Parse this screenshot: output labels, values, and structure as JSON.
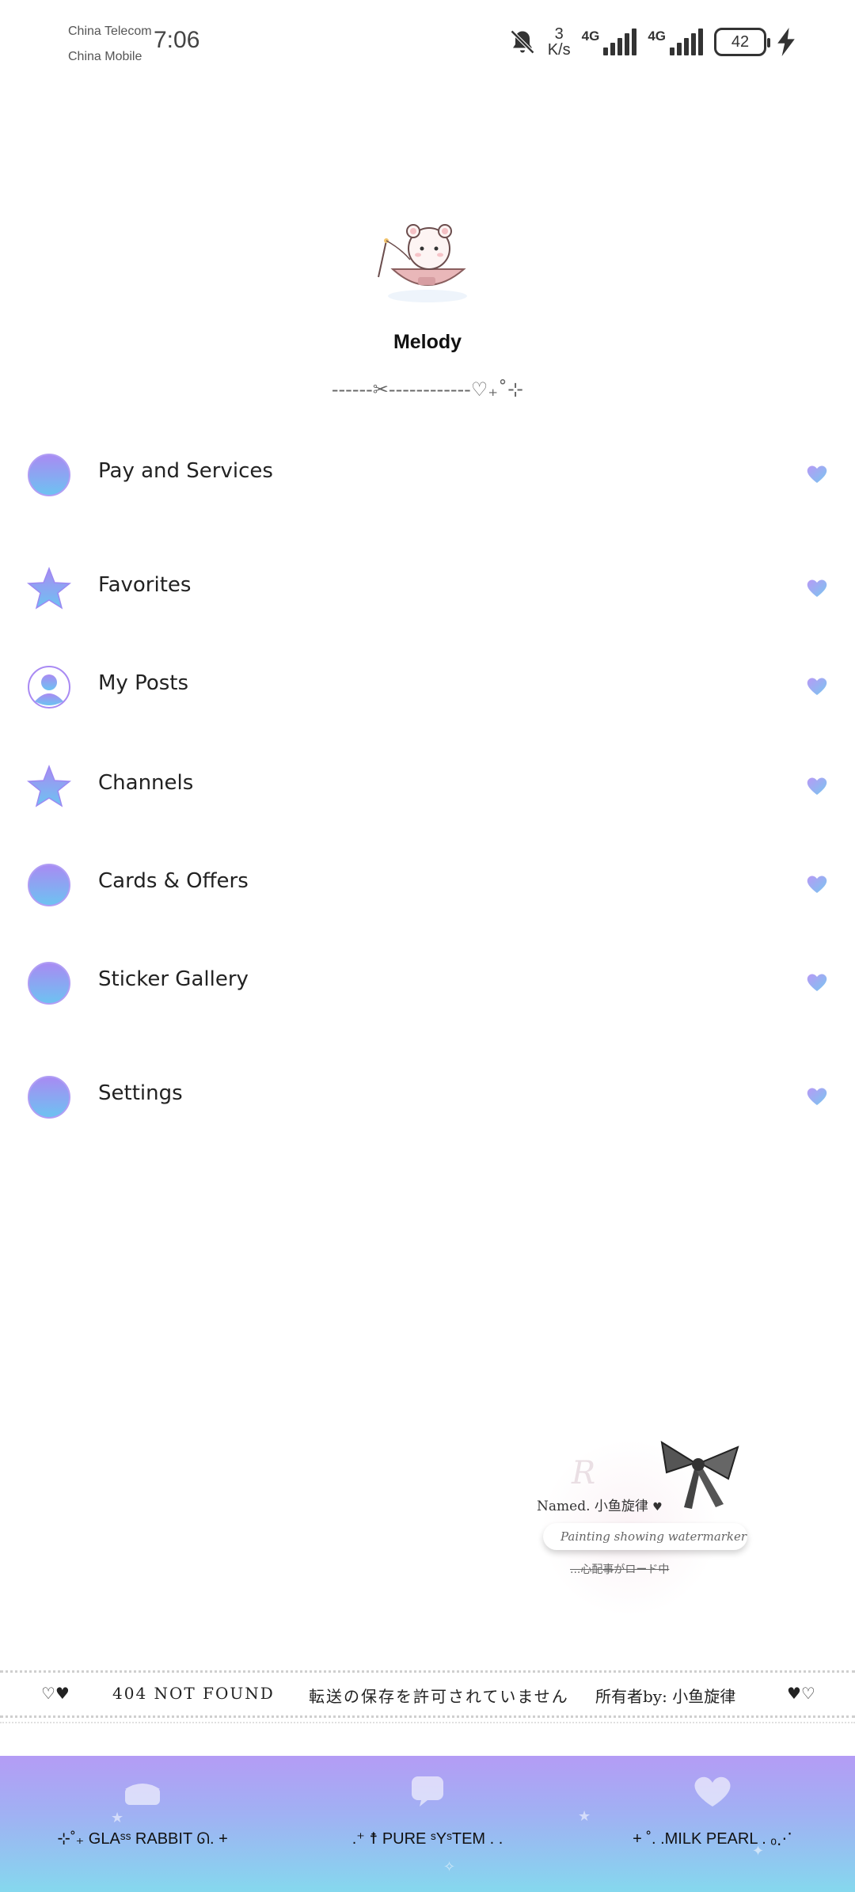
{
  "status_bar": {
    "carrier_1": "China Telecom",
    "carrier_2": "China Mobile",
    "time": "7:06",
    "speed_value": "3",
    "speed_unit": "K/s",
    "network_1": "4G",
    "network_2": "4G",
    "battery": "42",
    "icons": [
      "bell-muted-icon",
      "signal-icon",
      "battery-icon",
      "charging-bolt-icon"
    ]
  },
  "profile": {
    "name": "Melody",
    "divider": "------✂------------♡₊˚⊹",
    "avatar_icon": "bear-in-boat-illustration"
  },
  "menu": {
    "items": [
      {
        "label": "Pay and Services",
        "icon": "round-gradient-icon"
      },
      {
        "label": "Favorites",
        "icon": "star-icon"
      },
      {
        "label": "My Posts",
        "icon": "person-icon"
      },
      {
        "label": "Channels",
        "icon": "star-icon"
      },
      {
        "label": "Cards & Offers",
        "icon": "round-gradient-icon"
      },
      {
        "label": "Sticker Gallery",
        "icon": "round-gradient-icon"
      },
      {
        "label": "Settings",
        "icon": "round-gradient-icon"
      }
    ],
    "trailing_icon": "heart-icon"
  },
  "watermark": {
    "named": "Named. 小鱼旋律",
    "heart": "♥",
    "painting": "Painting showing watermarker",
    "loading": "...心配事がロード中",
    "background_letter": "R"
  },
  "ticker": {
    "left_hearts": "♡♥",
    "not_found": "404 NOT FOUND",
    "no_save": "転送の保存を許可されていません",
    "owner": "所有者by: 小鱼旋律",
    "right_hearts": "♥♡"
  },
  "bottom_tabs": [
    {
      "label": "⊹˚₊ GLAˢˢ RABBIT ᘏ. +"
    },
    {
      "label": ".⁺ ☨ PURE ˢYˢTEM . ."
    },
    {
      "label": "+ ˚. .MILK PEARL . ₒ⋰"
    }
  ],
  "colors": {
    "gradient_top": "#b49cf5",
    "gradient_mid": "#9fb2f3",
    "gradient_bottom": "#85d8ee",
    "icon_purple": "#9b7cf0",
    "icon_blue": "#6fb8f0"
  }
}
